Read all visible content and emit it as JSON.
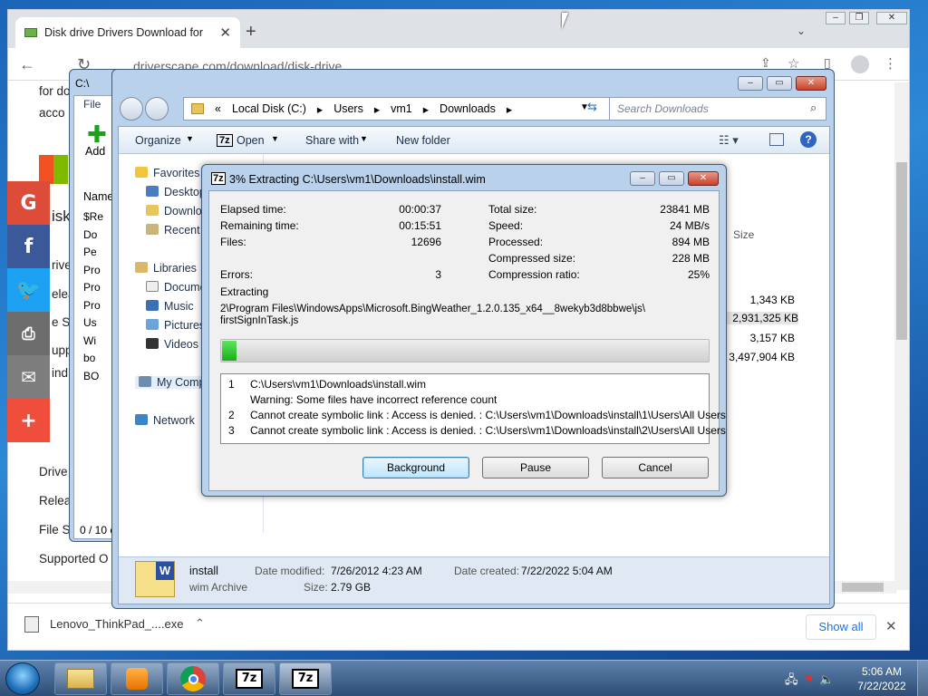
{
  "chrome": {
    "tab_title": "Disk drive Drivers Download for",
    "url": "driverscape.com/download/disk-drive",
    "page_lines": {
      "for_do": "for do",
      "acco": "acco",
      "isk": "isk",
      "rive": "rive",
      "elea": "elea",
      "e_s": "e S",
      "upp": "upp",
      "ind": "ind",
      "drive": "Drive",
      "relea": "Relea",
      "file_s": "File S",
      "supported": "Supported O"
    },
    "download": {
      "name": "Lenovo_ThinkPad_....exe",
      "show_all": "Show all"
    },
    "social": [
      "G",
      "f",
      "t",
      "print",
      "mail",
      "+"
    ]
  },
  "explorer": {
    "title_fragment": "C:\\",
    "file_menu": "File",
    "add_label": "Add",
    "breadcrumb": [
      "«",
      "Local Disk (C:)",
      "Users",
      "vm1",
      "Downloads"
    ],
    "search_placeholder": "Search Downloads",
    "commands": [
      "Organize",
      "Open",
      "Share with",
      "New folder"
    ],
    "column_name": "Name",
    "column_size": "Size",
    "nav": {
      "favorites": "Favorites",
      "desktop": "Desktop",
      "downloads": "Downlo",
      "recent": "Recent P",
      "libraries": "Libraries",
      "documents": "Docume",
      "music": "Music",
      "pictures": "Pictures",
      "videos": "Videos",
      "computer": "My Comp",
      "network": "Network"
    },
    "back_rows": [
      "$Re",
      "Do",
      "Pe",
      "Pro",
      "Pro",
      "Pro",
      "Us",
      "Wi",
      "bo",
      "BO"
    ],
    "items_status": "0 / 10 c",
    "sizes": [
      "1,343 KB",
      "2,931,325 KB",
      "3,157 KB",
      "3,497,904 KB"
    ],
    "details": {
      "name": "install",
      "type": "wim Archive",
      "date_modified_label": "Date modified:",
      "date_modified": "7/26/2012 4:23 AM",
      "date_created_label": "Date created:",
      "date_created": "7/22/2022 5:04 AM",
      "size_label": "Size:",
      "size": "2.79 GB"
    }
  },
  "dialog": {
    "title": "3% Extracting C:\\Users\\vm1\\Downloads\\install.wim",
    "elapsed_label": "Elapsed time:",
    "elapsed": "00:00:37",
    "remaining_label": "Remaining time:",
    "remaining": "00:15:51",
    "files_label": "Files:",
    "files": "12696",
    "errors_label": "Errors:",
    "errors": "3",
    "total_label": "Total size:",
    "total": "23841 MB",
    "speed_label": "Speed:",
    "speed": "24 MB/s",
    "processed_label": "Processed:",
    "processed": "894 MB",
    "compressed_label": "Compressed size:",
    "compressed": "228 MB",
    "ratio_label": "Compression ratio:",
    "ratio": "25%",
    "extracting_label": "Extracting",
    "current_path_1": "2\\Program Files\\WindowsApps\\Microsoft.BingWeather_1.2.0.135_x64__8wekyb3d8bbwe\\js\\",
    "current_path_2": "firstSignInTask.js",
    "progress": 0.03,
    "log": [
      {
        "n": "1",
        "text": "C:\\Users\\vm1\\Downloads\\install.wim"
      },
      {
        "n": "",
        "text": "Warning: Some files have incorrect reference count"
      },
      {
        "n": "2",
        "text": "Cannot create symbolic link : Access is denied. : C:\\Users\\vm1\\Downloads\\install\\1\\Users\\All Users"
      },
      {
        "n": "3",
        "text": "Cannot create symbolic link : Access is denied. : C:\\Users\\vm1\\Downloads\\install\\2\\Users\\All Users"
      }
    ],
    "buttons": {
      "background": "Background",
      "pause": "Pause",
      "cancel": "Cancel"
    }
  },
  "taskbar": {
    "time": "5:06 AM",
    "date": "7/22/2022",
    "seven_zip": "7z"
  }
}
